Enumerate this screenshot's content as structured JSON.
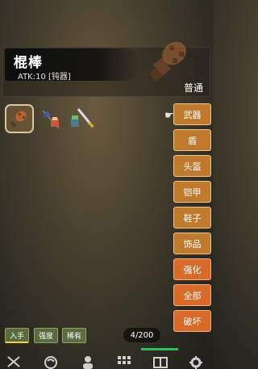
{
  "item": {
    "name": "棍棒",
    "stat": "ATK:10 [钝器]",
    "rarity": "普通",
    "favorite_icon": "star-icon"
  },
  "inventory": [
    {
      "icon": "club-icon",
      "selected": true
    },
    {
      "icon": "axe-hero-icon",
      "selected": false
    },
    {
      "icon": "sword-hero-icon",
      "selected": false
    }
  ],
  "categories": [
    "武器",
    "盾",
    "头盔",
    "铠甲",
    "鞋子",
    "饰品",
    "强化",
    "全部",
    "破坏"
  ],
  "filters": [
    "入手",
    "强度",
    "稀有"
  ],
  "count": "4/200",
  "nav": [
    "swords-icon",
    "globe-icon",
    "person-icon",
    "grid-icon",
    "book-icon",
    "gear-icon"
  ],
  "colors": {
    "category_button": "#c07a2e",
    "filter_button": "#5a6b3e",
    "selected_slot_border": "#d9c79c",
    "progress": "#2fbf5a"
  }
}
